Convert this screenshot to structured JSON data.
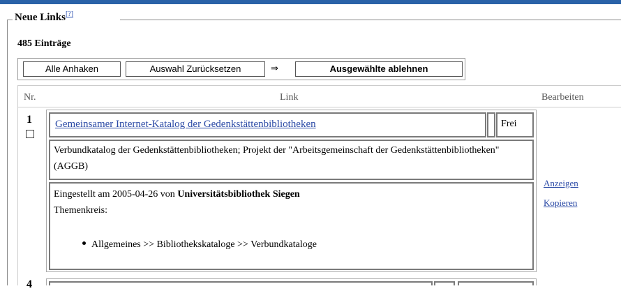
{
  "section": {
    "legend": "Neue Links",
    "help_sup": "[?]",
    "entry_count": "485 Einträge"
  },
  "toolbar": {
    "check_all_label": "Alle Anhaken",
    "reset_label": "Auswahl Zurücksetzen",
    "arrow": "⇒",
    "reject_label": "Ausgewählte ablehnen"
  },
  "table": {
    "col_nr": "Nr.",
    "col_link": "Link",
    "col_edit": "Bearbeiten"
  },
  "entry": {
    "number": "1",
    "title": "Gemeinsamer Internet-Katalog der Gedenkstättenbibliotheken",
    "status": "Frei",
    "description": "Verbundkatalog der Gedenkstättenbibliotheken; Projekt der \"Arbeitsgemeinschaft der Gedenkstättenbibliotheken\" (AGGB)",
    "submitted_prefix": "Eingestellt am 2005-04-26 von",
    "submitted_by": "Universitätsbibliothek Siegen",
    "themes_label": "Themenkreis:",
    "theme_path": "Allgemeines >> Bibliothekskataloge >> Verbundkataloge",
    "action_show": "Anzeigen",
    "action_copy": "Kopieren"
  },
  "next_entry": {
    "number": "4"
  }
}
